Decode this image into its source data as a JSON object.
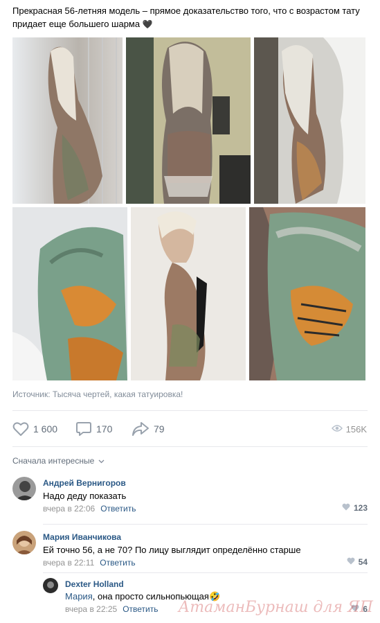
{
  "post": {
    "text": "Прекрасная 56-летняя модель – прямое доказательство того, что с возрастом тату придает еще большего шарма",
    "emoji": "🖤",
    "source_label": "Источник: Тысяча чертей, какая татуировка!"
  },
  "actions": {
    "likes": "1 600",
    "comments": "170",
    "shares": "79",
    "views": "156K"
  },
  "comments_sort": "Сначала интересные",
  "comments": [
    {
      "author": "Андрей Вернигоров",
      "text": "Надо деду показать",
      "time": "вчера в 22:06",
      "reply": "Ответить",
      "likes": "123"
    },
    {
      "author": "Мария Иванчикова",
      "text": "Ей точно 56, а не 70? По лицу выглядит определённо старше",
      "time": "вчера в 22:11",
      "reply": "Ответить",
      "likes": "54"
    },
    {
      "author": "Dexter Holland",
      "mention": "Мария",
      "text": ", она просто сильнопьющая",
      "emoji": "🤣",
      "time": "вчера в 22:25",
      "reply": "Ответить",
      "likes": "6"
    }
  ],
  "watermark": "АтаманБурнаш для ЯП",
  "colors": {
    "link": "#2a5885",
    "meta": "#939393",
    "action": "#626d7a",
    "divider": "#e7e8ec"
  }
}
